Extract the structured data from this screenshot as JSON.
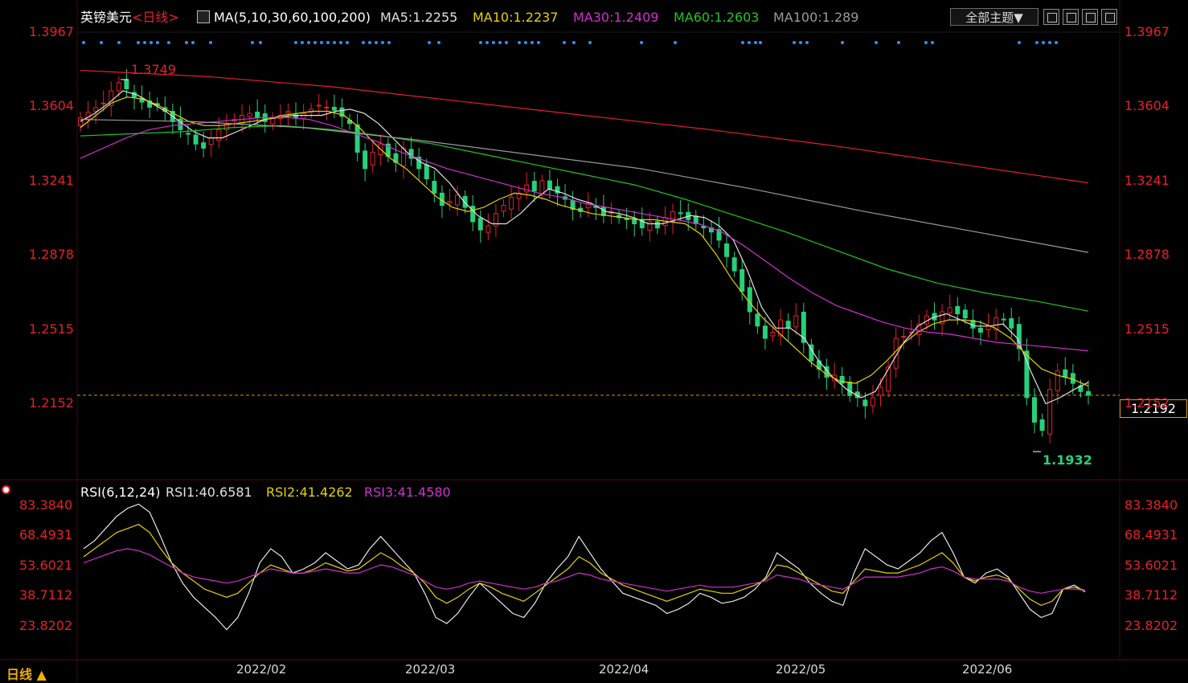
{
  "header": {
    "instrument": "英镑美元",
    "period_tag": "<日线>",
    "ma_params": "MA(5,10,30,60,100,200)",
    "ma5": "MA5:1.2255",
    "ma10": "MA10:1.2237",
    "ma30": "MA30:1.2409",
    "ma60": "MA60:1.2603",
    "ma100": "MA100:1.289",
    "topic_button": "全部主题▼"
  },
  "rsi_header": {
    "params": "RSI(6,12,24)",
    "rsi1": "RSI1:40.6581",
    "rsi2": "RSI2:41.4262",
    "rsi3": "RSI3:41.4580"
  },
  "price_axis": [
    "1.3967",
    "1.3604",
    "1.3241",
    "1.2878",
    "1.2515",
    "1.2152"
  ],
  "rsi_axis": [
    "83.3840",
    "68.4931",
    "53.6021",
    "38.7112",
    "23.8202"
  ],
  "current_price": "1.2192",
  "high_label": "1.3749",
  "low_label": "1.1932",
  "period_tab": "日线 ▲",
  "dates": [
    "2022/02",
    "2022/03",
    "2022/04",
    "2022/05",
    "2022/06"
  ],
  "colors": {
    "up": "#e5202c",
    "down": "#27d07a",
    "ma5": "#e0e0e0",
    "ma10": "#e6d200",
    "ma30": "#d030d0",
    "ma60": "#22c322",
    "ma100": "#9a9a9a",
    "ma200": "#e5202c",
    "axis": "#e5202c",
    "dots": "#2f8fff"
  },
  "chart_data": [
    {
      "type": "candlestick",
      "title": "英镑美元 日线",
      "x_range": [
        "2022-01",
        "2022-06"
      ],
      "ylim": [
        1.1932,
        1.3967
      ],
      "high": 1.3749,
      "low": 1.1932,
      "last_close": 1.2192,
      "closes": [
        1.3548,
        1.3575,
        1.3598,
        1.362,
        1.368,
        1.372,
        1.369,
        1.365,
        1.3625,
        1.36,
        1.361,
        1.358,
        1.353,
        1.349,
        1.347,
        1.342,
        1.34,
        1.345,
        1.349,
        1.352,
        1.354,
        1.356,
        1.357,
        1.355,
        1.353,
        1.3545,
        1.356,
        1.358,
        1.355,
        1.357,
        1.359,
        1.361,
        1.36,
        1.3585,
        1.3555,
        1.352,
        1.338,
        1.33,
        1.338,
        1.342,
        1.336,
        1.333,
        1.34,
        1.335,
        1.33,
        1.325,
        1.318,
        1.312,
        1.314,
        1.317,
        1.311,
        1.304,
        1.3,
        1.302,
        1.308,
        1.312,
        1.316,
        1.318,
        1.322,
        1.319,
        1.324,
        1.32,
        1.318,
        1.315,
        1.31,
        1.309,
        1.313,
        1.311,
        1.307,
        1.309,
        1.306,
        1.305,
        1.303,
        1.301,
        1.304,
        1.301,
        1.306,
        1.309,
        1.308,
        1.305,
        1.303,
        1.301,
        1.299,
        1.295,
        1.287,
        1.28,
        1.27,
        1.26,
        1.253,
        1.247,
        1.25,
        1.256,
        1.252,
        1.258,
        1.245,
        1.236,
        1.232,
        1.228,
        1.229,
        1.225,
        1.219,
        1.218,
        1.214,
        1.218,
        1.223,
        1.233,
        1.247,
        1.248,
        1.25,
        1.254,
        1.258,
        1.256,
        1.26,
        1.262,
        1.259,
        1.257,
        1.252,
        1.25,
        1.253,
        1.257,
        1.256,
        1.252,
        1.242,
        1.218,
        1.206,
        1.202,
        1.222,
        1.231,
        1.228,
        1.225,
        1.221,
        1.2192
      ],
      "ma_series": [
        {
          "name": "MA5",
          "values": [
            1.353,
            1.357,
            1.362,
            1.368,
            1.366,
            1.362,
            1.358,
            1.353,
            1.348,
            1.345,
            1.345,
            1.348,
            1.351,
            1.354,
            1.355,
            1.356,
            1.356,
            1.356,
            1.358,
            1.359,
            1.357,
            1.352,
            1.345,
            1.338,
            1.333,
            1.33,
            1.323,
            1.314,
            1.307,
            1.303,
            1.303,
            1.308,
            1.315,
            1.32,
            1.318,
            1.315,
            1.313,
            1.309,
            1.308,
            1.306,
            1.303,
            1.303,
            1.305,
            1.307,
            1.306,
            1.302,
            1.295,
            1.28,
            1.262,
            1.252,
            1.252,
            1.247,
            1.236,
            1.228,
            1.222,
            1.218,
            1.221,
            1.233,
            1.245,
            1.253,
            1.257,
            1.259,
            1.256,
            1.253,
            1.253,
            1.254,
            1.247,
            1.23,
            1.215,
            1.218,
            1.222,
            1.2255
          ]
        },
        {
          "name": "MA10",
          "values": [
            1.35,
            1.356,
            1.362,
            1.365,
            1.364,
            1.361,
            1.357,
            1.353,
            1.351,
            1.351,
            1.352,
            1.353,
            1.354,
            1.356,
            1.357,
            1.358,
            1.358,
            1.356,
            1.35,
            1.342,
            1.335,
            1.33,
            1.323,
            1.316,
            1.311,
            1.309,
            1.311,
            1.315,
            1.318,
            1.317,
            1.315,
            1.312,
            1.31,
            1.308,
            1.307,
            1.306,
            1.305,
            1.305,
            1.304,
            1.303,
            1.298,
            1.288,
            1.276,
            1.266,
            1.257,
            1.25,
            1.243,
            1.236,
            1.23,
            1.226,
            1.225,
            1.229,
            1.236,
            1.244,
            1.25,
            1.254,
            1.256,
            1.256,
            1.255,
            1.252,
            1.247,
            1.239,
            1.232,
            1.229,
            1.227,
            1.2237
          ]
        },
        {
          "name": "MA30",
          "values": [
            1.335,
            1.34,
            1.345,
            1.349,
            1.351,
            1.352,
            1.353,
            1.354,
            1.355,
            1.355,
            1.354,
            1.351,
            1.347,
            1.343,
            1.338,
            1.334,
            1.33,
            1.327,
            1.324,
            1.321,
            1.318,
            1.316,
            1.313,
            1.311,
            1.309,
            1.307,
            1.305,
            1.303,
            1.299,
            1.292,
            1.284,
            1.276,
            1.269,
            1.263,
            1.259,
            1.255,
            1.252,
            1.25,
            1.249,
            1.247,
            1.245,
            1.244,
            1.243,
            1.242,
            1.2409
          ]
        },
        {
          "name": "MA60",
          "values": [
            1.346,
            1.347,
            1.348,
            1.35,
            1.351,
            1.349,
            1.346,
            1.342,
            1.337,
            1.332,
            1.327,
            1.322,
            1.315,
            1.307,
            1.299,
            1.29,
            1.281,
            1.274,
            1.269,
            1.265,
            1.2603
          ]
        },
        {
          "name": "MA100",
          "values": [
            1.354,
            1.353,
            1.35,
            1.344,
            1.337,
            1.33,
            1.32,
            1.309,
            1.299,
            1.289
          ]
        },
        {
          "name": "MA200",
          "values": [
            1.378,
            1.375,
            1.37,
            1.363,
            1.356,
            1.349,
            1.341,
            1.332,
            1.323
          ]
        }
      ]
    },
    {
      "type": "line",
      "title": "RSI(6,12,24)",
      "ylim": [
        23.8202,
        83.384
      ],
      "series": [
        {
          "name": "RSI1",
          "values": [
            62,
            66,
            72,
            78,
            82,
            84,
            80,
            68,
            55,
            45,
            38,
            33,
            28,
            22,
            28,
            40,
            55,
            62,
            58,
            50,
            52,
            55,
            60,
            56,
            52,
            54,
            62,
            68,
            62,
            56,
            50,
            40,
            28,
            25,
            30,
            38,
            45,
            40,
            35,
            30,
            28,
            35,
            45,
            52,
            58,
            68,
            60,
            52,
            46,
            40,
            38,
            36,
            34,
            30,
            32,
            35,
            40,
            38,
            35,
            36,
            38,
            42,
            48,
            60,
            56,
            52,
            45,
            40,
            36,
            34,
            50,
            62,
            58,
            54,
            52,
            56,
            60,
            66,
            70,
            60,
            48,
            45,
            50,
            52,
            48,
            40,
            32,
            28,
            30,
            42,
            44,
            40.6581
          ]
        },
        {
          "name": "RSI2",
          "values": [
            58,
            62,
            66,
            70,
            72,
            74,
            70,
            62,
            55,
            50,
            46,
            42,
            40,
            38,
            40,
            45,
            50,
            54,
            52,
            50,
            50,
            52,
            55,
            53,
            51,
            52,
            56,
            60,
            57,
            53,
            50,
            45,
            38,
            35,
            38,
            42,
            45,
            43,
            40,
            38,
            36,
            40,
            44,
            48,
            52,
            58,
            55,
            50,
            47,
            44,
            42,
            40,
            38,
            36,
            38,
            40,
            42,
            41,
            40,
            40,
            42,
            44,
            47,
            54,
            53,
            50,
            47,
            44,
            41,
            40,
            46,
            52,
            51,
            50,
            50,
            52,
            54,
            57,
            60,
            55,
            48,
            46,
            48,
            49,
            47,
            42,
            37,
            34,
            36,
            42,
            43,
            41.4262
          ]
        },
        {
          "name": "RSI3",
          "values": [
            55,
            57,
            59,
            61,
            62,
            61,
            59,
            56,
            53,
            50,
            48,
            47,
            46,
            45,
            46,
            48,
            50,
            52,
            51,
            50,
            50,
            51,
            52,
            51,
            50,
            50,
            52,
            54,
            53,
            51,
            49,
            46,
            43,
            42,
            43,
            45,
            46,
            45,
            44,
            43,
            42,
            43,
            45,
            46,
            48,
            50,
            49,
            47,
            46,
            45,
            44,
            43,
            42,
            41,
            42,
            43,
            44,
            43,
            43,
            43,
            44,
            45,
            46,
            49,
            48,
            47,
            45,
            44,
            43,
            42,
            45,
            48,
            48,
            48,
            48,
            49,
            50,
            52,
            53,
            51,
            48,
            47,
            47,
            47,
            46,
            43,
            41,
            40,
            41,
            42,
            42,
            41.458
          ]
        }
      ]
    }
  ]
}
